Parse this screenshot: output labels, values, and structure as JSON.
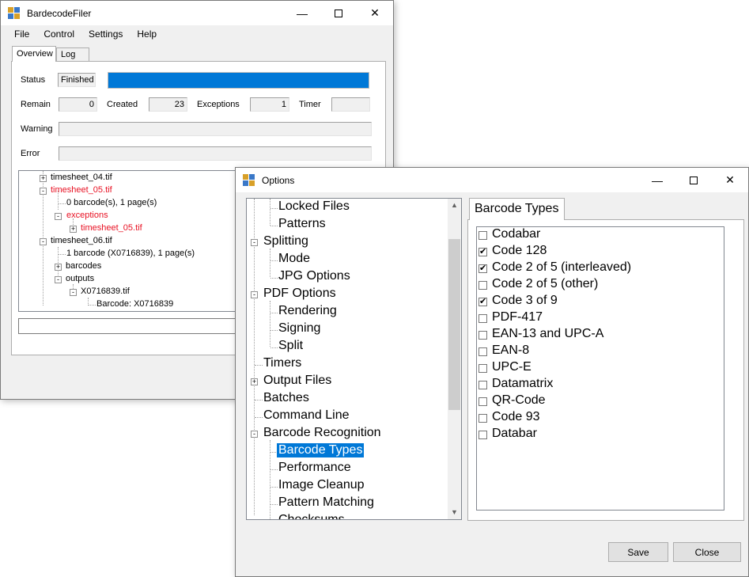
{
  "main_window": {
    "title": "BardecodeFiler",
    "menu": [
      "File",
      "Control",
      "Settings",
      "Help"
    ],
    "tabs": [
      "Overview",
      "Log"
    ],
    "status_label": "Status",
    "status_value": "Finished",
    "progress": 1.0,
    "remain_label": "Remain",
    "remain_value": "0",
    "created_label": "Created",
    "created_value": "23",
    "exceptions_label": "Exceptions",
    "exceptions_value": "1",
    "timer_label": "Timer",
    "timer_value": "",
    "warning_label": "Warning",
    "warning_value": "",
    "error_label": "Error",
    "error_value": "",
    "tree": [
      {
        "text": "timesheet_04.tif",
        "red": false,
        "expander": "+"
      },
      {
        "text": "timesheet_05.tif",
        "red": true,
        "expander": "-"
      },
      {
        "text": "0 barcode(s), 1 page(s)",
        "red": false,
        "expander": ""
      },
      {
        "text": "exceptions",
        "red": true,
        "expander": "-"
      },
      {
        "text": "timesheet_05.tif",
        "red": true,
        "expander": "+"
      },
      {
        "text": "timesheet_06.tif",
        "red": false,
        "expander": "-"
      },
      {
        "text": "1 barcode (X0716839), 1 page(s)",
        "red": false,
        "expander": ""
      },
      {
        "text": "barcodes",
        "red": false,
        "expander": "+"
      },
      {
        "text": "outputs",
        "red": false,
        "expander": "-"
      },
      {
        "text": "X0716839.tif",
        "red": false,
        "expander": "-"
      },
      {
        "text": "Barcode: X0716839",
        "red": false,
        "expander": ""
      }
    ]
  },
  "options_window": {
    "title": "Options",
    "tree": [
      {
        "text": "Locked Files",
        "level": 1,
        "expander": "",
        "selected": false
      },
      {
        "text": "Patterns",
        "level": 1,
        "expander": "",
        "selected": false
      },
      {
        "text": "Splitting",
        "level": 0,
        "expander": "-",
        "selected": false
      },
      {
        "text": "Mode",
        "level": 1,
        "expander": "",
        "selected": false
      },
      {
        "text": "JPG Options",
        "level": 1,
        "expander": "",
        "selected": false
      },
      {
        "text": "PDF Options",
        "level": 0,
        "expander": "-",
        "selected": false
      },
      {
        "text": "Rendering",
        "level": 1,
        "expander": "",
        "selected": false
      },
      {
        "text": "Signing",
        "level": 1,
        "expander": "",
        "selected": false
      },
      {
        "text": "Split",
        "level": 1,
        "expander": "",
        "selected": false
      },
      {
        "text": "Timers",
        "level": 0,
        "expander": "",
        "selected": false
      },
      {
        "text": "Output Files",
        "level": 0,
        "expander": "+",
        "selected": false
      },
      {
        "text": "Batches",
        "level": 0,
        "expander": "",
        "selected": false
      },
      {
        "text": "Command Line",
        "level": 0,
        "expander": "",
        "selected": false
      },
      {
        "text": "Barcode Recognition",
        "level": 0,
        "expander": "-",
        "selected": false
      },
      {
        "text": "Barcode Types",
        "level": 1,
        "expander": "",
        "selected": true
      },
      {
        "text": "Performance",
        "level": 1,
        "expander": "",
        "selected": false
      },
      {
        "text": "Image Cleanup",
        "level": 1,
        "expander": "",
        "selected": false
      },
      {
        "text": "Pattern Matching",
        "level": 1,
        "expander": "",
        "selected": false
      },
      {
        "text": "Checksums",
        "level": 1,
        "expander": "",
        "selected": false
      }
    ],
    "panel_tab": "Barcode Types",
    "barcode_types": [
      {
        "label": "Codabar",
        "checked": false
      },
      {
        "label": "Code 128",
        "checked": true
      },
      {
        "label": "Code 2 of 5 (interleaved)",
        "checked": true
      },
      {
        "label": "Code 2 of 5 (other)",
        "checked": false
      },
      {
        "label": "Code 3 of 9",
        "checked": true
      },
      {
        "label": "PDF-417",
        "checked": false
      },
      {
        "label": "EAN-13 and UPC-A",
        "checked": false
      },
      {
        "label": "EAN-8",
        "checked": false
      },
      {
        "label": "UPC-E",
        "checked": false
      },
      {
        "label": "Datamatrix",
        "checked": false
      },
      {
        "label": "QR-Code",
        "checked": false
      },
      {
        "label": "Code 93",
        "checked": false
      },
      {
        "label": "Databar",
        "checked": false
      }
    ],
    "save_label": "Save",
    "close_label": "Close"
  },
  "colors": {
    "progress": "#0078d7",
    "selection": "#0078d7",
    "error_text": "#e81123"
  },
  "icons": [
    "app-icon",
    "minimize-icon",
    "maximize-icon",
    "close-icon",
    "scroll-up-icon",
    "scroll-down-icon"
  ]
}
